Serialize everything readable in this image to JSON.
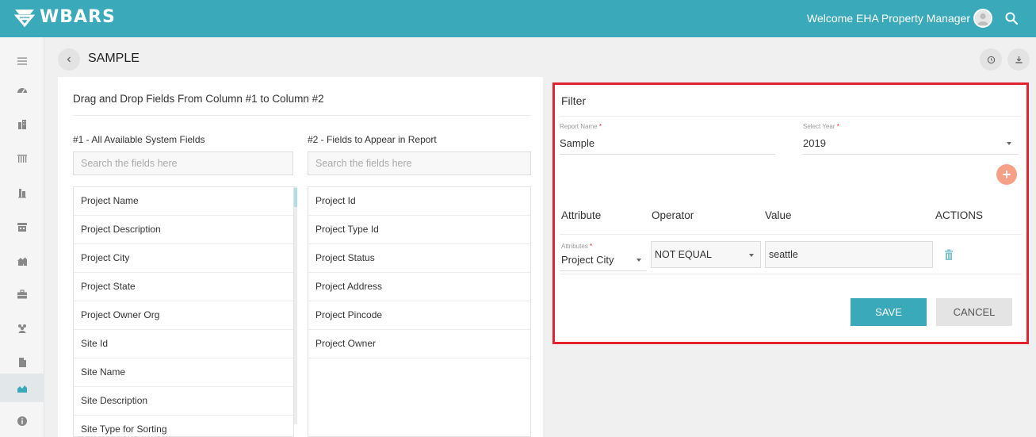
{
  "header": {
    "brand": "WBARS",
    "welcome_text": "Welcome EHA Property Manager",
    "accent_color": "#3aa9ba",
    "icons": [
      "wbars-logo-icon",
      "user-avatar-icon",
      "search-icon"
    ]
  },
  "sidebar": {
    "items": [
      {
        "icon": "menu-icon",
        "active": false
      },
      {
        "icon": "dashboard-gauge-icon",
        "active": false
      },
      {
        "icon": "building-icon",
        "active": false
      },
      {
        "icon": "columns-icon",
        "active": false
      },
      {
        "icon": "tower-icon",
        "active": false
      },
      {
        "icon": "store-icon",
        "active": false
      },
      {
        "icon": "houses-icon",
        "active": false
      },
      {
        "icon": "briefcase-icon",
        "active": false
      },
      {
        "icon": "users-icon",
        "active": false
      },
      {
        "icon": "document-icon",
        "active": false
      },
      {
        "icon": "reports-chart-icon",
        "active": true
      },
      {
        "icon": "info-icon",
        "active": false
      }
    ]
  },
  "page": {
    "title": "SAMPLE",
    "back_icon": "chevron-left-icon",
    "actions": [
      "history-icon",
      "download-icon"
    ]
  },
  "builder": {
    "heading": "Drag and Drop Fields From Column #1 to Column #2",
    "column1": {
      "title": "#1 - All Available System Fields",
      "search_placeholder": "Search the fields here",
      "items": [
        "Project Name",
        "Project Description",
        "Project City",
        "Project State",
        "Project Owner Org",
        "Site Id",
        "Site Name",
        "Site Description",
        "Site Type for Sorting"
      ]
    },
    "column2": {
      "title": "#2 - Fields to Appear in Report",
      "search_placeholder": "Search the fields here",
      "items": [
        "Project Id",
        "Project Type Id",
        "Project Status",
        "Project Address",
        "Project Pincode",
        "Project Owner"
      ]
    }
  },
  "filter": {
    "title": "Filter",
    "report_name": {
      "label": "Report Name",
      "required_mark": "*",
      "value": "Sample"
    },
    "select_year": {
      "label": "Select Year",
      "required_mark": "*",
      "value": "2019"
    },
    "add_icon": "plus-circle-icon",
    "columns": [
      "Attribute",
      "Operator",
      "Value",
      "ACTIONS"
    ],
    "row": {
      "attribute_label": "Attributes",
      "attribute_required": "*",
      "attribute_value": "Project City",
      "operator_value": "NOT EQUAL",
      "value": "seattle",
      "delete_icon": "trash-icon"
    },
    "save_label": "SAVE",
    "cancel_label": "CANCEL",
    "highlight_color": "#e32330"
  }
}
